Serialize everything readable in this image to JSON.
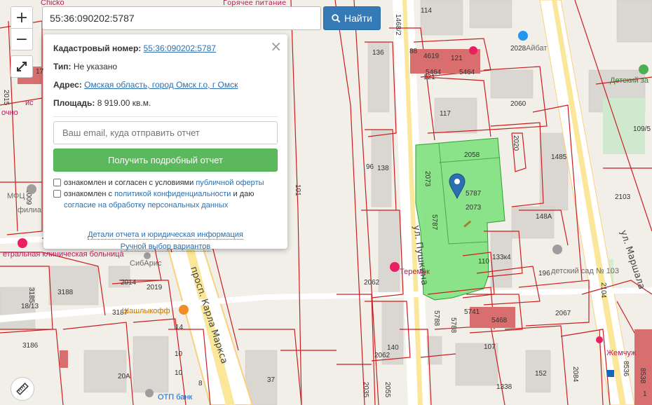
{
  "search": {
    "value": "55:36:090202:5787",
    "button_label": "Найти"
  },
  "controls": {
    "zoom_in": "+",
    "zoom_out": "−"
  },
  "popup": {
    "cadastral_label": "Кадастровый номер:",
    "cadastral_value": "55:36:090202:5787",
    "type_label": "Тип:",
    "type_value": "Не указано",
    "address_label": "Адрес:",
    "address_value": "Омская область, город Омск г.о, г Омск",
    "area_label": "Площадь:",
    "area_value": "8 919.00 кв.м.",
    "email_placeholder": "Ваш email, куда отправить отчет",
    "report_button": "Получить подробный отчет",
    "consent1_text": "ознакомлен и согласен с условиями",
    "consent1_link": "публичной оферты",
    "consent2_text_a": "ознакомлен с",
    "consent2_link_a": "политикой конфиденциальности",
    "consent2_text_b": "и даю",
    "consent2_link_b": "согласие на обработку персональных данных",
    "details_link": "Детали отчета и юридическая информация",
    "manual_link": "Ручной выбор вариантов"
  },
  "map": {
    "streets": [
      "просп. Карла Маркса",
      "ул. Пушкина",
      "ул. Маршала",
      "Горячее питание"
    ],
    "parcel_labels": [
      "2058",
      "2073",
      "5787",
      "2073",
      "5787",
      "2020",
      "2060",
      "1485",
      "148A",
      "2103",
      "114",
      "1468/2",
      "136",
      "88",
      "4619",
      "121",
      "5464",
      "5464",
      "121",
      "2028",
      "117",
      "138",
      "96",
      "101",
      "110",
      "133к4",
      "196",
      "2104",
      "2067",
      "5741",
      "5468",
      "5788",
      "5788",
      "2062",
      "140",
      "2062",
      "107",
      "152",
      "2084",
      "1338",
      "2035",
      "2055",
      "2014",
      "2019",
      "3188",
      "3187",
      "3186",
      "18/13",
      "3185",
      "14",
      "10",
      "10",
      "8",
      "20A",
      "37",
      "2015",
      "2009",
      "17",
      "8536",
      "8538",
      "109/5",
      "1"
    ],
    "pois": [
      "СибАрис",
      "Шашлыкофф",
      "Теремок",
      "Детский за",
      "детский сад № 103",
      "Жемчуж",
      "ОТП банк",
      "Chicko",
      "МФЦ",
      "Айбат",
      "филиа",
      "етральная клиническая больница",
      "очно",
      "ис"
    ],
    "colors": {
      "parcel_fill": "#78e078",
      "boundary": "#c81e1e",
      "marker": "#2a6fb0"
    }
  }
}
